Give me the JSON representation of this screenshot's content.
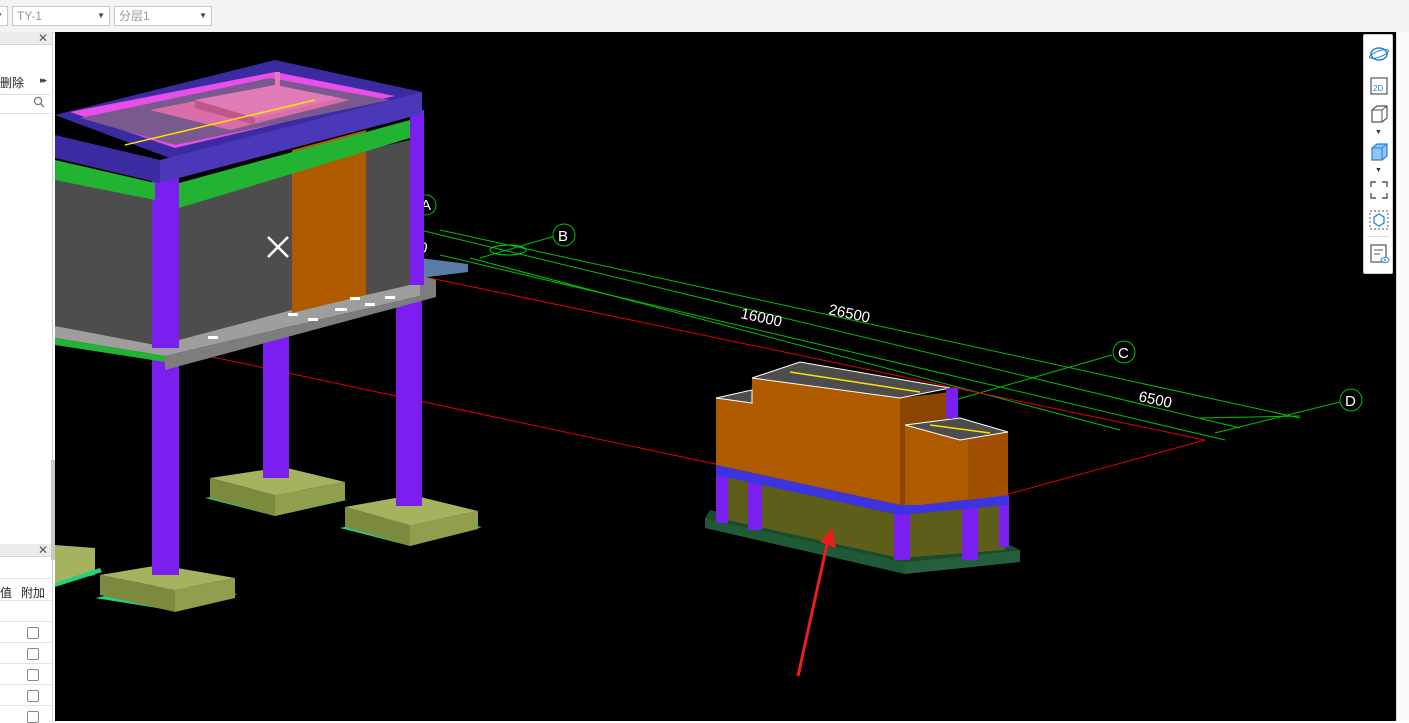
{
  "toolbar": {
    "dropdown_component": "TY-1",
    "dropdown_layer": "分层1"
  },
  "left_panel": {
    "delete_label": "删除",
    "table_headers": [
      "值",
      "附加"
    ]
  },
  "viewport": {
    "axis_labels": [
      "A",
      "B",
      "C",
      "D"
    ],
    "dim_top_partial": "00",
    "dimensions": [
      "16000",
      "26500",
      "6500"
    ]
  },
  "view_toolbar": {
    "button_2d": "2D"
  },
  "colors": {
    "viewport_bg": "#000000",
    "column": "#7a1ff0",
    "beam": "#4a38b8",
    "wall": "#4d4d4d",
    "wall_accent": "#b05a00",
    "foundation": "#a5b35f",
    "axis_line": "#00c000",
    "red_line": "#e00000",
    "highlight_arrow": "#ee1d1d"
  }
}
